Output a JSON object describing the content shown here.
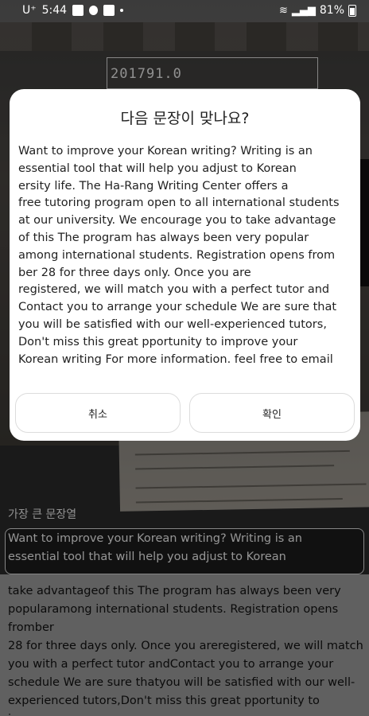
{
  "status_bar": {
    "carrier": "U⁺",
    "time": "5:44",
    "battery": "81%"
  },
  "background": {
    "frame_text": "201791.0"
  },
  "dialog": {
    "title": "다음 문장이 맞나요?",
    "body": "Want to improve your Korean writing? Writing is an\nessential tool that will help you adjust to Korean\nersity life. The Ha-Rang Writing Center offers a\nfree tutoring program open to all international students\nat our university. We encourage you to take advantage\nof this The program has always been very popular\namong international students. Registration opens from\nber 28 for three days only. Once you are\nregistered, we will match you with a perfect tutor and\nContact you to arrange your schedule We are sure that\nyou will be satisfied with our well-experienced tutors,\nDon't miss this great pportunity to improve your\nKorean writing For more information. feel free to email",
    "cancel_label": "취소",
    "ok_label": "확인"
  },
  "result": {
    "title": "가장 큰 문장열",
    "selected_text": "Want to improve your Korean writing? Writing is an\nessential tool that will help you adjust to Korean",
    "remaining_text": "take advantageof this The program has always been very\npopularamong international students. Registration opens fromber\n28 for three days only. Once you areregistered, we will match\nyou with a perfect tutor andContact you to arrange your\nschedule We are sure thatyou will be satisfied with our well-\nexperienced tutors,Don't miss this great pportunity to improve\nyourKorean writing For more information. feel free to email"
  }
}
